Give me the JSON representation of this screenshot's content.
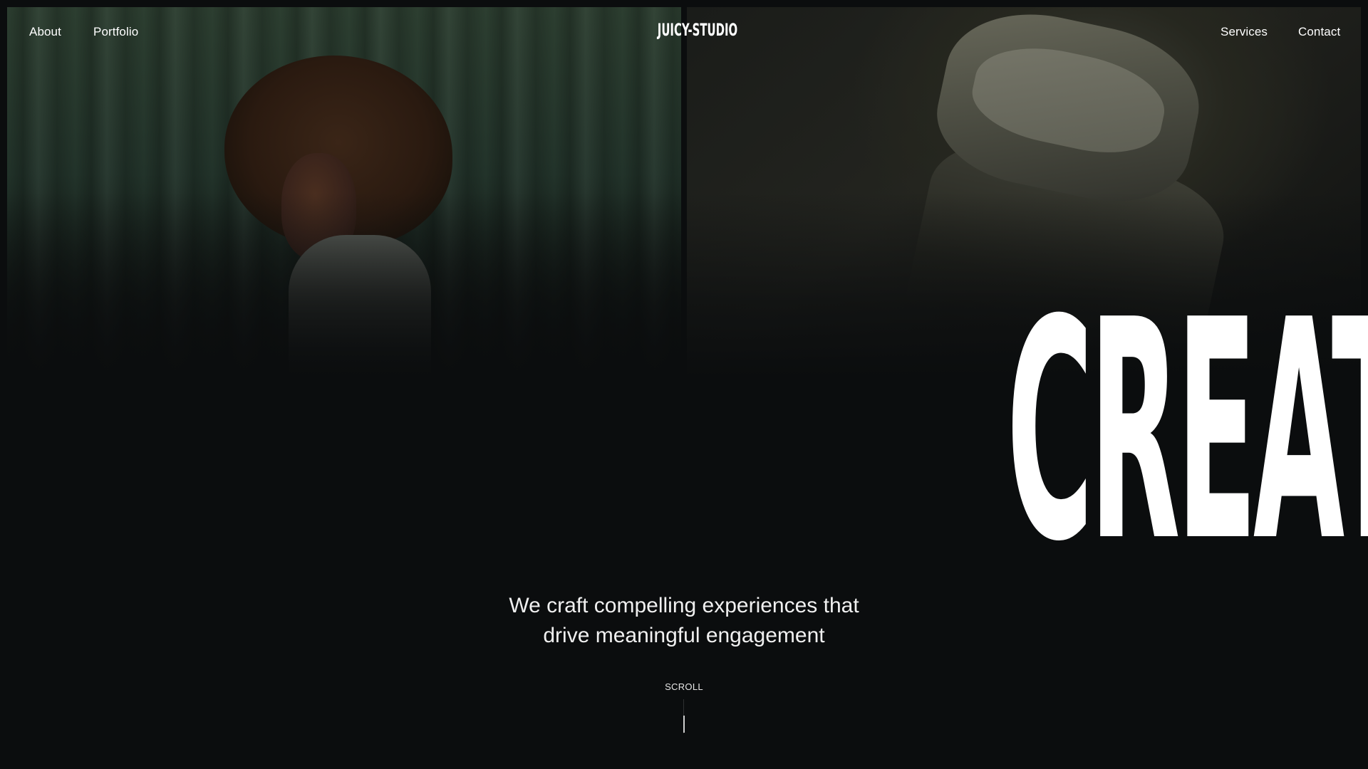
{
  "nav": {
    "left_links": [
      "About",
      "Portfolio"
    ],
    "logo": "JUICY-STUDIO",
    "right_links": [
      "Services",
      "Contact"
    ]
  },
  "hero": {
    "headline": "CREATIVE DESIGNER",
    "tagline_line1": "We craft compelling experiences that",
    "tagline_line2": "drive meaningful engagement",
    "scroll_label": "SCROLL"
  },
  "colors": {
    "background": "#0b0d0e",
    "text": "#ffffff",
    "left_photo_tint": "#2c3e30",
    "right_photo_tint": "#3c3d35"
  }
}
